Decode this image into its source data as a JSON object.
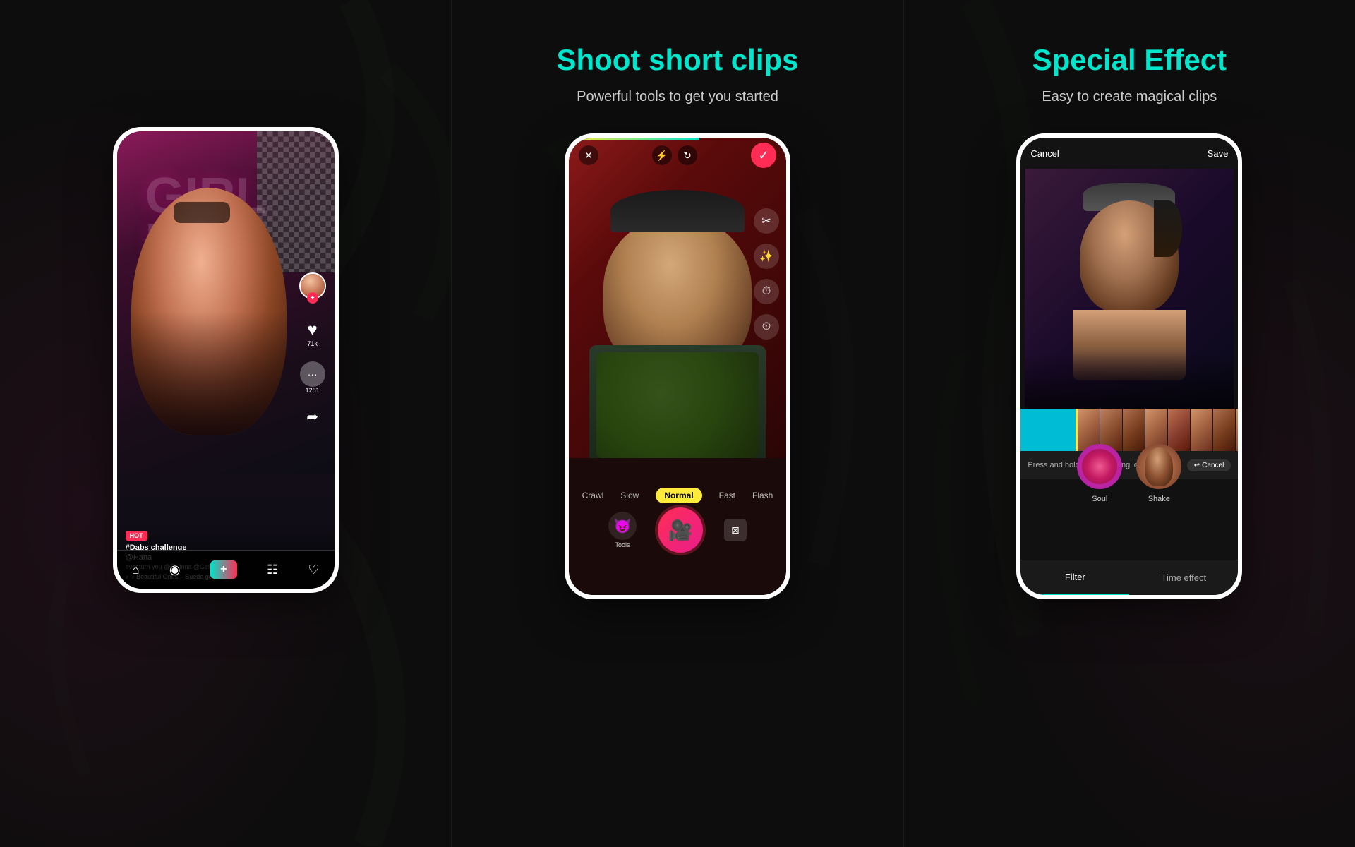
{
  "panels": {
    "left": {
      "title": "",
      "subtitle": "",
      "social": {
        "hot_badge": "HOT",
        "challenge": "#Dabs challenge",
        "username": "@Hana",
        "description": "over,turn you @Eelinna @GeleryGl",
        "music": "♪ Beautiful Ones – Suede goo",
        "likes": "71k",
        "comments": "1281",
        "neon_text": "GIRL\nIRL"
      },
      "nav": {
        "items": [
          "⌂",
          "◎",
          "+",
          "☰",
          "♡"
        ]
      }
    },
    "center": {
      "title": "Shoot short clips",
      "subtitle": "Powerful tools to get you started",
      "camera": {
        "speeds": [
          "Crawl",
          "Slow",
          "Normal",
          "Fast",
          "Flash"
        ],
        "active_speed": "Normal",
        "tools_label": "Tools"
      }
    },
    "right": {
      "title": "Special Effect",
      "subtitle": "Easy to create magical clips",
      "effects": {
        "cancel": "Cancel",
        "save": "Save",
        "instruction": "Press and hold after selecting location",
        "cancel_small": "↩ Cancel",
        "items": [
          {
            "name": "Soul",
            "type": "soul"
          },
          {
            "name": "Shake",
            "type": "shake"
          }
        ],
        "tabs": [
          "Filter",
          "Time effect"
        ]
      }
    }
  }
}
